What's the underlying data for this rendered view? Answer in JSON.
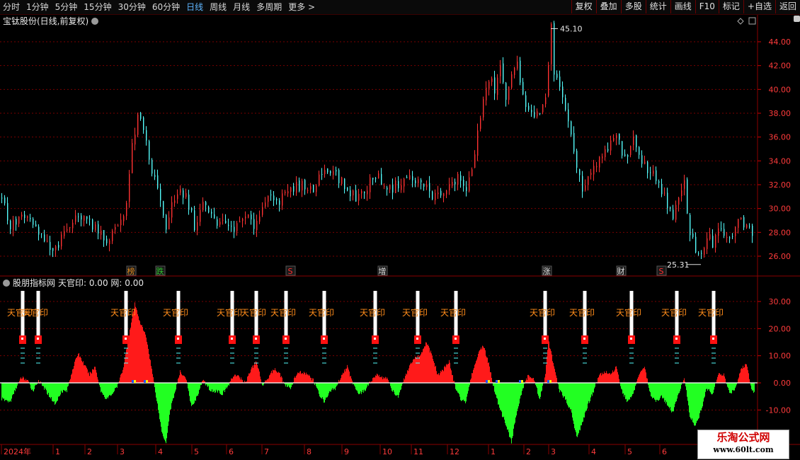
{
  "toolbar": {
    "tabs": [
      {
        "label": "分时",
        "active": false
      },
      {
        "label": "1分钟",
        "active": false
      },
      {
        "label": "5分钟",
        "active": false
      },
      {
        "label": "15分钟",
        "active": false
      },
      {
        "label": "30分钟",
        "active": false
      },
      {
        "label": "60分钟",
        "active": false
      },
      {
        "label": "日线",
        "active": true
      },
      {
        "label": "周线",
        "active": false
      },
      {
        "label": "月线",
        "active": false
      },
      {
        "label": "多周期",
        "active": false
      },
      {
        "label": "更多 >",
        "active": false
      }
    ],
    "right_buttons": [
      "复权",
      "叠加",
      "多股",
      "统计",
      "画线",
      "F10",
      "标记",
      "+自选",
      "返回"
    ]
  },
  "main_chart": {
    "title": "宝钛股份(日线,前复权)",
    "y_ticks": [
      "44.00",
      "42.00",
      "40.00",
      "38.00",
      "36.00",
      "34.00",
      "32.00",
      "30.00",
      "28.00",
      "26.00"
    ],
    "high_label": "45.10",
    "low_label": "25.31",
    "markers": [
      {
        "text": "榜",
        "color": "#e08a1e"
      },
      {
        "text": "跌",
        "color": "#2ec12e"
      },
      {
        "text": "S",
        "color": "#ff3030"
      },
      {
        "text": "增",
        "color": "#e0e0e0"
      },
      {
        "text": "涨",
        "color": "#e0e0e0"
      },
      {
        "text": "财",
        "color": "#e0e0e0"
      },
      {
        "text": "S",
        "color": "#ff3030"
      }
    ]
  },
  "indicator": {
    "title": "股朋指标网",
    "readout": "天官印: 0.00  网: 0.00",
    "signal_label": "天官印",
    "y_ticks": [
      "30.00",
      "20.00",
      "10.00",
      "0.00",
      "-10.00"
    ]
  },
  "date_axis": {
    "labels": [
      "2024年",
      "1",
      "2",
      "3",
      "4",
      "5",
      "6",
      "7",
      "8",
      "9",
      "10",
      "11",
      "12",
      "1",
      "2",
      "3",
      "4",
      "5",
      "6"
    ]
  },
  "watermark": {
    "line1": "乐淘公式网",
    "line2": "www.60lt.com"
  },
  "colors": {
    "up": "#ff3232",
    "down": "#54fcfc",
    "pos_area": "#ff1a1a",
    "neg_area": "#22ff22",
    "grid": "#7a0000"
  },
  "chart_data": {
    "type": "candlestick",
    "price_range": [
      24.8,
      45.6
    ],
    "price_knots": [
      [
        0,
        31.0
      ],
      [
        6,
        28.4
      ],
      [
        14,
        29.4
      ],
      [
        22,
        28.6
      ],
      [
        30,
        27.3
      ],
      [
        36,
        26.2
      ],
      [
        42,
        27.4
      ],
      [
        50,
        28.9
      ],
      [
        58,
        29.7
      ],
      [
        64,
        28.6
      ],
      [
        72,
        27.4
      ],
      [
        78,
        27.8
      ],
      [
        84,
        29.3
      ],
      [
        88,
        30.2
      ],
      [
        92,
        35.5
      ],
      [
        97,
        38.0
      ],
      [
        102,
        35.5
      ],
      [
        106,
        33.2
      ],
      [
        110,
        31.8
      ],
      [
        113,
        30.5
      ],
      [
        116,
        27.8
      ],
      [
        120,
        30.2
      ],
      [
        126,
        31.4
      ],
      [
        130,
        31.0
      ],
      [
        136,
        28.6
      ],
      [
        142,
        30.3
      ],
      [
        150,
        29.0
      ],
      [
        158,
        28.6
      ],
      [
        166,
        28.4
      ],
      [
        172,
        29.3
      ],
      [
        178,
        28.6
      ],
      [
        184,
        30.1
      ],
      [
        190,
        31.4
      ],
      [
        196,
        30.6
      ],
      [
        202,
        31.3
      ],
      [
        208,
        31.8
      ],
      [
        214,
        32.0
      ],
      [
        220,
        31.5
      ],
      [
        226,
        33.1
      ],
      [
        232,
        33.4
      ],
      [
        238,
        32.5
      ],
      [
        244,
        31.5
      ],
      [
        250,
        31.0
      ],
      [
        256,
        31.3
      ],
      [
        262,
        32.8
      ],
      [
        268,
        32.4
      ],
      [
        274,
        31.6
      ],
      [
        280,
        32.1
      ],
      [
        286,
        32.6
      ],
      [
        292,
        32.3
      ],
      [
        298,
        32.0
      ],
      [
        304,
        31.2
      ],
      [
        310,
        30.9
      ],
      [
        316,
        31.8
      ],
      [
        322,
        32.6
      ],
      [
        328,
        31.8
      ],
      [
        332,
        33.0
      ],
      [
        336,
        36.5
      ],
      [
        340,
        38.8
      ],
      [
        344,
        41.0
      ],
      [
        348,
        40.0
      ],
      [
        352,
        41.8
      ],
      [
        356,
        39.3
      ],
      [
        360,
        40.9
      ],
      [
        364,
        42.2
      ],
      [
        368,
        39.8
      ],
      [
        372,
        38.0
      ],
      [
        376,
        37.4
      ],
      [
        380,
        38.4
      ],
      [
        384,
        39.5
      ],
      [
        386,
        42.0
      ],
      [
        388,
        45.1
      ],
      [
        390,
        41.5
      ],
      [
        394,
        40.0
      ],
      [
        398,
        38.0
      ],
      [
        402,
        35.8
      ],
      [
        406,
        33.8
      ],
      [
        410,
        31.5
      ],
      [
        414,
        32.6
      ],
      [
        418,
        33.2
      ],
      [
        422,
        34.0
      ],
      [
        426,
        34.6
      ],
      [
        430,
        35.5
      ],
      [
        434,
        36.2
      ],
      [
        438,
        34.8
      ],
      [
        442,
        34.4
      ],
      [
        446,
        35.6
      ],
      [
        450,
        34.6
      ],
      [
        454,
        33.7
      ],
      [
        458,
        33.0
      ],
      [
        462,
        32.6
      ],
      [
        466,
        31.6
      ],
      [
        470,
        30.4
      ],
      [
        474,
        29.0
      ],
      [
        478,
        30.8
      ],
      [
        482,
        32.0
      ],
      [
        486,
        28.0
      ],
      [
        490,
        26.5
      ],
      [
        494,
        26.2
      ],
      [
        498,
        27.8
      ],
      [
        502,
        27.0
      ],
      [
        506,
        28.3
      ],
      [
        510,
        27.5
      ],
      [
        514,
        27.3
      ],
      [
        518,
        28.5
      ],
      [
        522,
        29.0
      ],
      [
        526,
        28.5
      ],
      [
        530,
        28.0
      ]
    ],
    "osc_knots": [
      [
        0,
        -6
      ],
      [
        6,
        -7
      ],
      [
        10,
        -2
      ],
      [
        14,
        2
      ],
      [
        18,
        1
      ],
      [
        22,
        -3
      ],
      [
        26,
        1
      ],
      [
        30,
        -2
      ],
      [
        34,
        -5
      ],
      [
        38,
        -8
      ],
      [
        42,
        -3
      ],
      [
        46,
        -3
      ],
      [
        50,
        5
      ],
      [
        54,
        11
      ],
      [
        58,
        7
      ],
      [
        62,
        3
      ],
      [
        66,
        6
      ],
      [
        70,
        -3
      ],
      [
        74,
        -6
      ],
      [
        78,
        -4
      ],
      [
        82,
        -1
      ],
      [
        86,
        6
      ],
      [
        90,
        18
      ],
      [
        94,
        29
      ],
      [
        98,
        22
      ],
      [
        102,
        17
      ],
      [
        106,
        5
      ],
      [
        110,
        -8
      ],
      [
        113,
        -18
      ],
      [
        116,
        -22
      ],
      [
        119,
        -10
      ],
      [
        122,
        -4
      ],
      [
        126,
        4
      ],
      [
        130,
        2
      ],
      [
        134,
        -9
      ],
      [
        138,
        -5
      ],
      [
        142,
        1
      ],
      [
        148,
        -3
      ],
      [
        152,
        -3
      ],
      [
        156,
        -4
      ],
      [
        160,
        -1
      ],
      [
        164,
        3
      ],
      [
        168,
        2
      ],
      [
        172,
        0
      ],
      [
        176,
        5
      ],
      [
        180,
        8
      ],
      [
        184,
        -1
      ],
      [
        188,
        2
      ],
      [
        192,
        5
      ],
      [
        196,
        4
      ],
      [
        200,
        -1
      ],
      [
        204,
        -2
      ],
      [
        208,
        3
      ],
      [
        212,
        4
      ],
      [
        216,
        3
      ],
      [
        220,
        1
      ],
      [
        224,
        -4
      ],
      [
        228,
        -7
      ],
      [
        232,
        -3
      ],
      [
        236,
        -2
      ],
      [
        240,
        3
      ],
      [
        244,
        6
      ],
      [
        248,
        0
      ],
      [
        252,
        -4
      ],
      [
        256,
        -3
      ],
      [
        260,
        0
      ],
      [
        264,
        3
      ],
      [
        268,
        2
      ],
      [
        272,
        2
      ],
      [
        276,
        -3
      ],
      [
        280,
        -5
      ],
      [
        284,
        1
      ],
      [
        288,
        6
      ],
      [
        292,
        9
      ],
      [
        296,
        10
      ],
      [
        300,
        15
      ],
      [
        304,
        10
      ],
      [
        308,
        3
      ],
      [
        312,
        5
      ],
      [
        316,
        8
      ],
      [
        320,
        -1
      ],
      [
        324,
        -6
      ],
      [
        328,
        -7
      ],
      [
        332,
        3
      ],
      [
        336,
        10
      ],
      [
        340,
        14
      ],
      [
        344,
        7
      ],
      [
        348,
        -3
      ],
      [
        352,
        -10
      ],
      [
        356,
        -15
      ],
      [
        360,
        -22
      ],
      [
        364,
        -10
      ],
      [
        368,
        -2
      ],
      [
        372,
        3
      ],
      [
        376,
        1
      ],
      [
        380,
        -6
      ],
      [
        384,
        3
      ],
      [
        386,
        16
      ],
      [
        390,
        6
      ],
      [
        394,
        -3
      ],
      [
        398,
        -6
      ],
      [
        402,
        -10
      ],
      [
        406,
        -20
      ],
      [
        410,
        -15
      ],
      [
        414,
        -8
      ],
      [
        418,
        -3
      ],
      [
        422,
        3
      ],
      [
        426,
        4
      ],
      [
        430,
        3
      ],
      [
        434,
        6
      ],
      [
        438,
        -3
      ],
      [
        442,
        -7
      ],
      [
        446,
        -4
      ],
      [
        450,
        3
      ],
      [
        454,
        6
      ],
      [
        458,
        -4
      ],
      [
        462,
        -7
      ],
      [
        466,
        -5
      ],
      [
        470,
        -8
      ],
      [
        474,
        -11
      ],
      [
        478,
        -4
      ],
      [
        482,
        2
      ],
      [
        486,
        -12
      ],
      [
        490,
        -16
      ],
      [
        494,
        -10
      ],
      [
        498,
        -2
      ],
      [
        502,
        -4
      ],
      [
        506,
        3
      ],
      [
        510,
        3
      ],
      [
        514,
        -4
      ],
      [
        518,
        -2
      ],
      [
        522,
        5
      ],
      [
        526,
        7
      ],
      [
        530,
        -3
      ]
    ],
    "signal_x": [
      32,
      54,
      178,
      252,
      328,
      362,
      404,
      458,
      530,
      590,
      644,
      770,
      826,
      892,
      956,
      1008
    ]
  }
}
